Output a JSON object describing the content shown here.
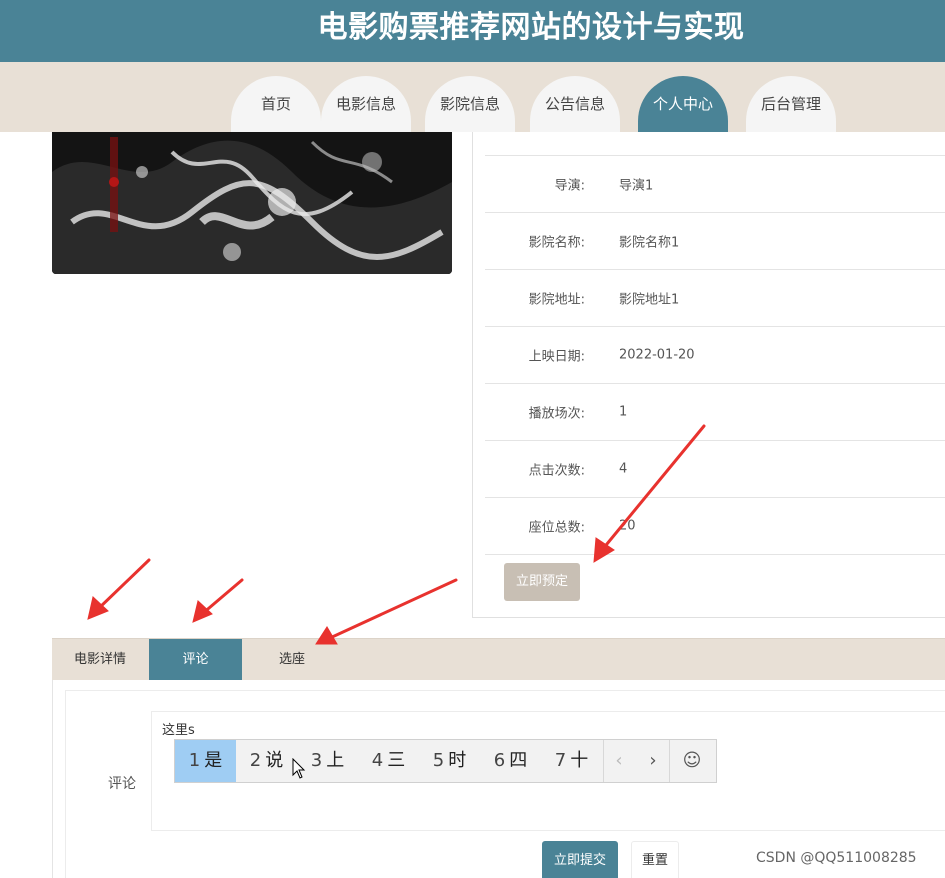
{
  "header": {
    "title": "电影购票推荐网站的设计与实现"
  },
  "nav": {
    "items": [
      {
        "label": "首页",
        "active": false
      },
      {
        "label": "电影信息",
        "active": false
      },
      {
        "label": "影院信息",
        "active": false
      },
      {
        "label": "公告信息",
        "active": false
      },
      {
        "label": "个人中心",
        "active": true
      },
      {
        "label": "后台管理",
        "active": false
      }
    ]
  },
  "details": {
    "rows": [
      {
        "label": "导演:",
        "value": "导演1"
      },
      {
        "label": "影院名称:",
        "value": "影院名称1"
      },
      {
        "label": "影院地址:",
        "value": "影院地址1"
      },
      {
        "label": "上映日期:",
        "value": "2022-01-20"
      },
      {
        "label": "播放场次:",
        "value": "1"
      },
      {
        "label": "点击次数:",
        "value": "4"
      },
      {
        "label": "座位总数:",
        "value": "20"
      }
    ],
    "book_button": "立即预定"
  },
  "tabs": [
    {
      "label": "电影详情",
      "active": false
    },
    {
      "label": "评论",
      "active": true
    },
    {
      "label": "选座",
      "active": false
    }
  ],
  "comment": {
    "label": "评论",
    "value": "这里s",
    "submit": "立即提交",
    "reset": "重置"
  },
  "ime": {
    "candidates": [
      {
        "num": "1",
        "text": "是"
      },
      {
        "num": "2",
        "text": "说"
      },
      {
        "num": "3",
        "text": "上"
      },
      {
        "num": "4",
        "text": "三"
      },
      {
        "num": "5",
        "text": "时"
      },
      {
        "num": "6",
        "text": "四"
      },
      {
        "num": "7",
        "text": "十"
      }
    ],
    "prev": "‹",
    "next": "›",
    "emoji": "☺"
  },
  "watermark": "CSDN @QQ511008285",
  "colors": {
    "primary": "#4a8396",
    "beige": "#e8e0d6",
    "annotation": "#e8322e"
  }
}
